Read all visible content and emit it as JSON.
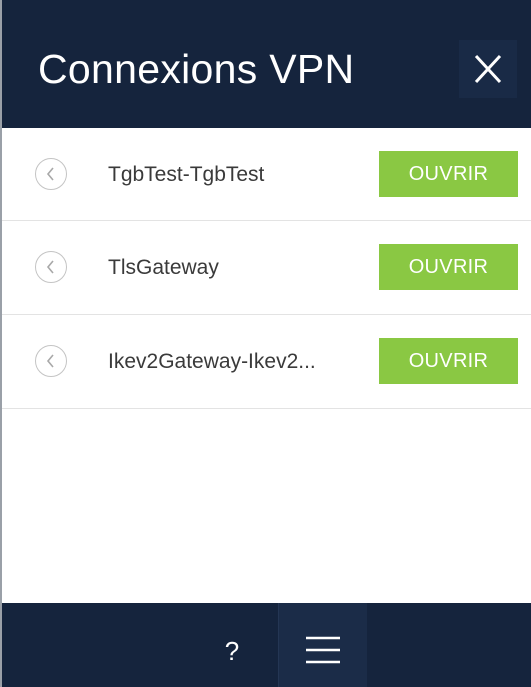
{
  "header": {
    "title": "Connexions VPN",
    "close_label": "X"
  },
  "connections": [
    {
      "name": "TgbTest-TgbTest",
      "action": "OUVRIR"
    },
    {
      "name": "TlsGateway",
      "action": "OUVRIR"
    },
    {
      "name": "Ikev2Gateway-Ikev2...",
      "action": "OUVRIR"
    }
  ],
  "footer": {
    "help_label": "?",
    "menu_icon": "hamburger-menu-icon"
  },
  "colors": {
    "header_bg": "#15243d",
    "accent_green": "#8ac843"
  }
}
